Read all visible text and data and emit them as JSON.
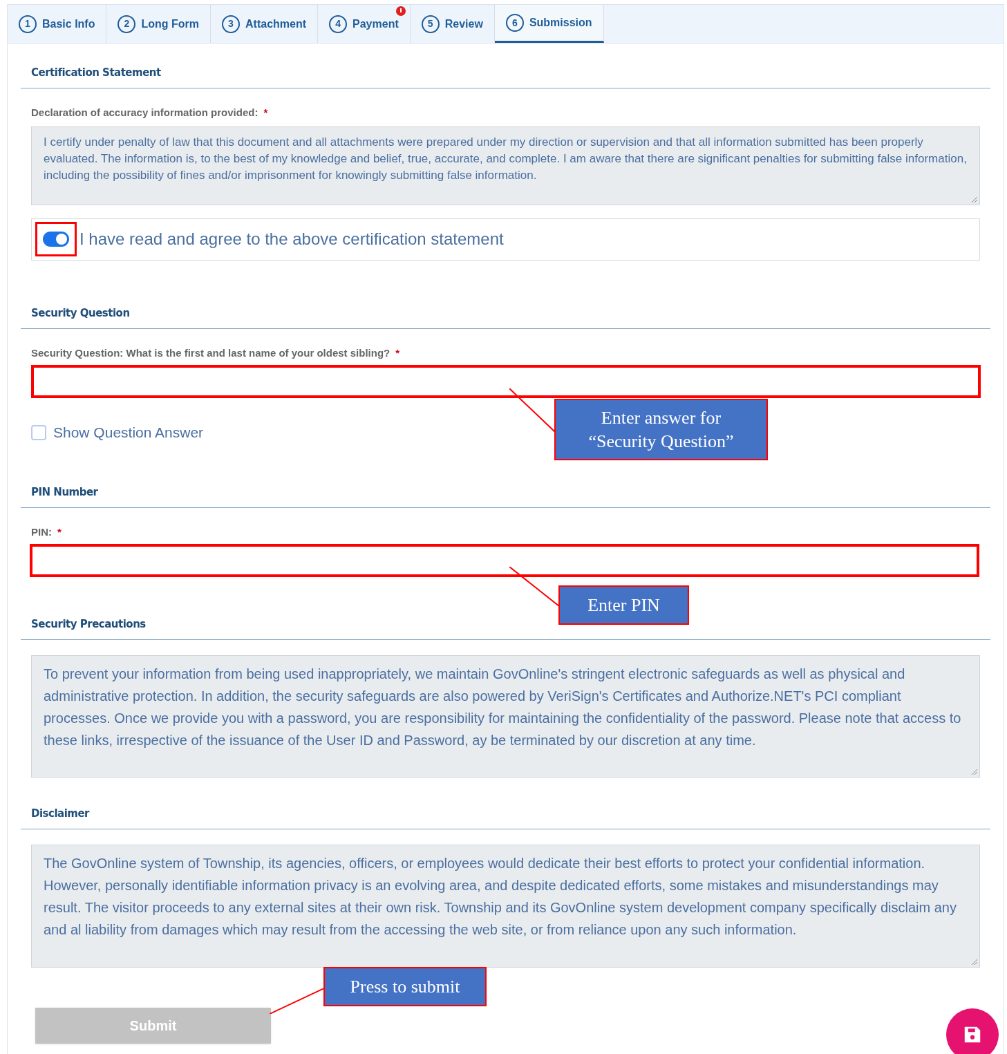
{
  "tabs": [
    {
      "number": "1",
      "label": "Basic Info",
      "selected": false,
      "alert": false
    },
    {
      "number": "2",
      "label": "Long Form",
      "selected": false,
      "alert": false
    },
    {
      "number": "3",
      "label": "Attachment",
      "selected": false,
      "alert": false
    },
    {
      "number": "4",
      "label": "Payment",
      "selected": false,
      "alert": true
    },
    {
      "number": "5",
      "label": "Review",
      "selected": false,
      "alert": false
    },
    {
      "number": "6",
      "label": "Submission",
      "selected": true,
      "alert": false
    }
  ],
  "certification": {
    "heading": "Certification Statement",
    "label": "Declaration of accuracy information provided:",
    "required": "*",
    "text": "I certify under penalty of law that this document and all attachments were prepared under my direction or supervision and that all information submitted has been properly evaluated. The information is, to the best of my knowledge and belief, true, accurate, and complete. I am aware that there are significant penalties for submitting false information, including the possibility of fines and/or imprisonment for knowingly submitting false information.",
    "agree": {
      "label": "I have read and agree to the above certification statement",
      "on": true
    }
  },
  "security_question": {
    "heading": "Security Question",
    "label": "Security Question: What is the first and last name of your oldest sibling?",
    "required": "*",
    "show_answer": {
      "label": "Show Question Answer",
      "checked": false
    }
  },
  "pin": {
    "heading": "PIN Number",
    "label": "PIN:",
    "required": "*"
  },
  "precautions": {
    "heading": "Security Precautions",
    "text": "To prevent your information from being used inappropriately, we maintain GovOnline's stringent electronic safeguards as well as physical and administrative protection. In addition, the security safeguards are also powered by VeriSign's Certificates and Authorize.NET's PCI compliant processes. Once we provide you with a password, you are responsibility for maintaining the confidentiality of the password. Please note that access to these links, irrespective of the issuance of the User ID and Password, ay be terminated by our discretion at any time."
  },
  "disclaimer": {
    "heading": "Disclaimer",
    "text": "The GovOnline system of Township, its agencies, officers, or employees would dedicate their best efforts to protect your confidential information. However, personally identifiable information privacy is an evolving area, and despite dedicated efforts, some mistakes and misunderstandings may result. The visitor proceeds to any external sites at their own risk. Township and its GovOnline system development company specifically disclaim any and al liability from damages which may result from the accessing the web site, or from reliance upon any such information."
  },
  "submit": {
    "label": "Submit",
    "disabled": true
  },
  "callouts": [
    "Enter answer for “Security Question”",
    "Enter PIN",
    "Press to submit"
  ]
}
